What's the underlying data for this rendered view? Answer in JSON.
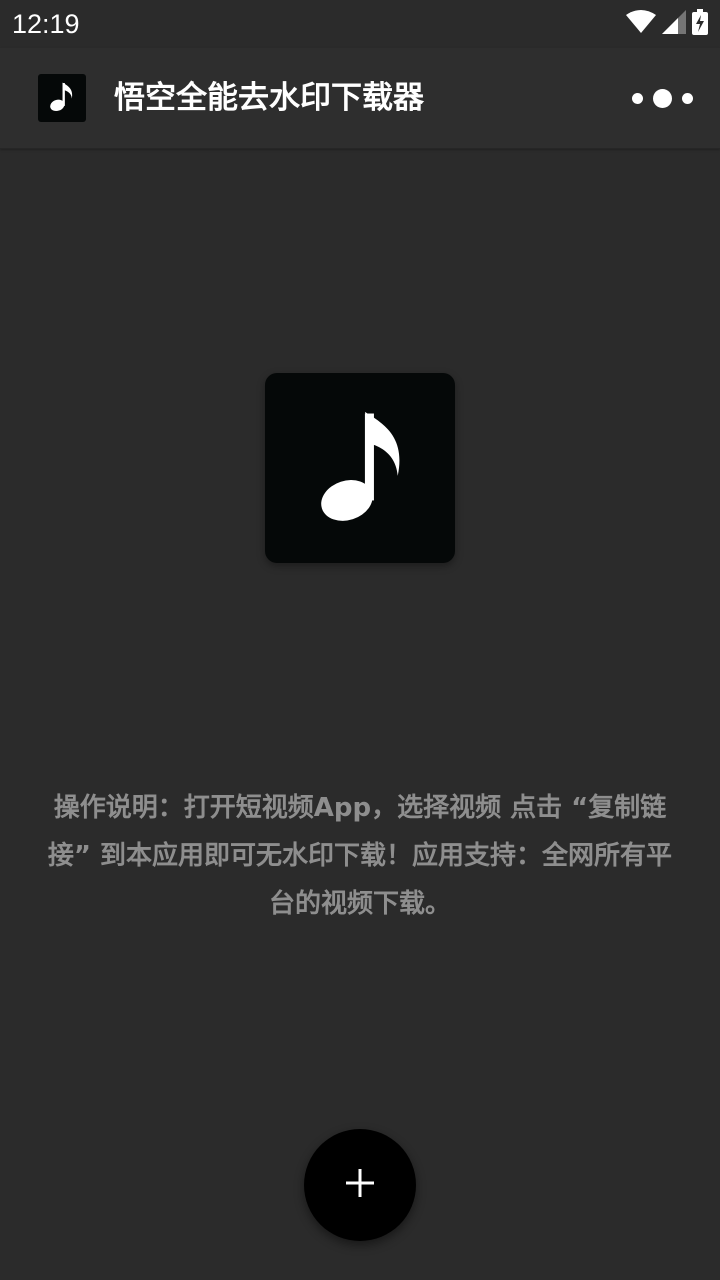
{
  "status_bar": {
    "time": "12:19",
    "icons": [
      "wifi-icon",
      "signal-icon",
      "battery-charging-icon"
    ]
  },
  "app_bar": {
    "logo_icon": "music-note-icon",
    "title": "悟空全能去水印下载器",
    "menu_icon": "more-dots-icon"
  },
  "main": {
    "logo_icon": "music-note-icon",
    "instructions": "操作说明：打开短视频App，选择视频 点击 “复制链接” 到本应用即可无水印下载！应用支持：全网所有平台的视频下载。"
  },
  "fab": {
    "icon": "plus-icon"
  },
  "colors": {
    "background": "#2b2b2b",
    "app_bar": "#2e2e2e",
    "logo_bg": "#050808",
    "instructions_text": "#8e8e8e",
    "fab": "#000000"
  }
}
